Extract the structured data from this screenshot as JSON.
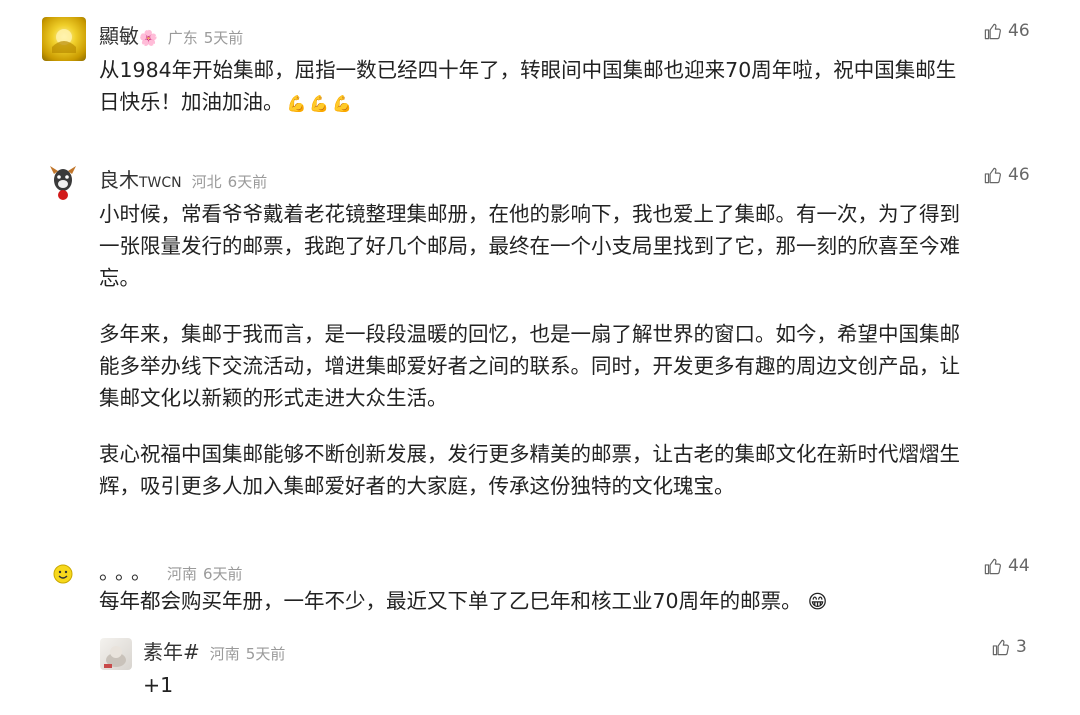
{
  "comments": [
    {
      "user": "顯敏",
      "user_emoji": "🌸",
      "location": "广东",
      "time": "5天前",
      "likes": "46",
      "lines": [
        "从1984年开始集邮，屈指一数已经四十年了，转眼间中国集邮也迎来70周年啦，祝中国集邮生",
        "日快乐！加油加油。"
      ],
      "trailing_emoji": [
        "💪",
        "💪",
        "💪"
      ]
    },
    {
      "user": "良木",
      "user_suffix": "TWCN",
      "location": "河北",
      "time": "6天前",
      "likes": "46",
      "p1": [
        "小时候，常看爷爷戴着老花镜整理集邮册，在他的影响下，我也爱上了集邮。有一次，为了得到",
        "一张限量发行的邮票，我跑了好几个邮局，最终在一个小支局里找到了它，那一刻的欣喜至今难",
        "忘。"
      ],
      "p2": [
        "多年来，集邮于我而言，是一段段温暖的回忆，也是一扇了解世界的窗口。如今，希望中国集邮",
        "能多举办线下交流活动，增进集邮爱好者之间的联系。同时，开发更多有趣的周边文创产品，让",
        "集邮文化以新颖的形式走进大众生活。"
      ],
      "p3": [
        "衷心祝福中国集邮能够不断创新发展，发行更多精美的邮票，让古老的集邮文化在新时代熠熠生",
        "辉，吸引更多人加入集邮爱好者的大家庭，传承这份独特的文化瑰宝。"
      ]
    },
    {
      "user": "。。。",
      "location": "河南",
      "time": "6天前",
      "likes": "44",
      "lines": [
        "每年都会购买年册，一年不少，最近又下单了乙巳年和核工业70周年的邮票。"
      ],
      "trailing_emoji": "😁",
      "reply": {
        "user": "素年#",
        "location": "河南",
        "time": "5天前",
        "likes": "3",
        "text": "+1"
      }
    }
  ],
  "icons": {
    "like": "thumbs-up-icon"
  },
  "colors": {
    "meta": "#9a9a9a",
    "text": "#222222",
    "avatar1": "#e2b900"
  }
}
